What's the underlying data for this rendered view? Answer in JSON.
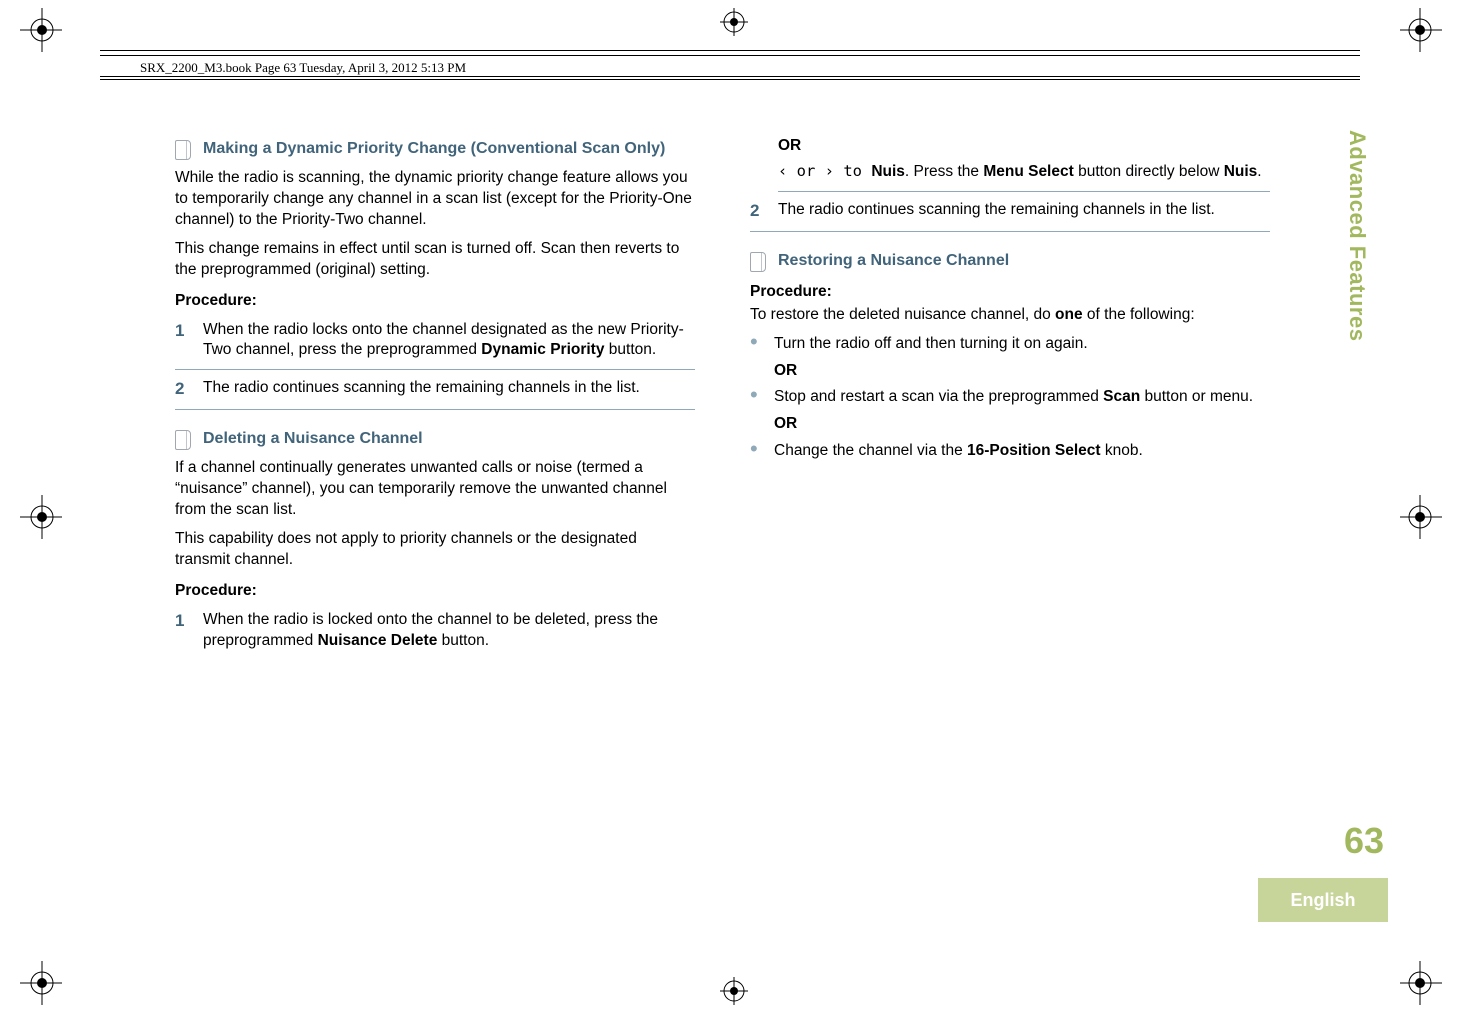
{
  "header_note": "SRX_2200_M3.book  Page 63  Tuesday, April 3, 2012  5:13 PM",
  "side_tab": "Advanced Features",
  "page_number": "63",
  "language": "English",
  "left": {
    "section1": {
      "title": "Making a Dynamic Priority Change (Conventional Scan Only)",
      "p1": "While the radio is scanning, the dynamic priority change feature allows you to temporarily change any channel in a scan list (except for the Priority-One channel) to the Priority-Two channel.",
      "p2": "This change remains in effect until scan is turned off. Scan then reverts to the preprogrammed (original) setting.",
      "proc": "Procedure:",
      "step1_num": "1",
      "step1_a": "When the radio locks onto the channel designated as the new Priority-Two channel, press the preprogrammed ",
      "step1_b": "Dynamic Priority",
      "step1_c": " button.",
      "step2_num": "2",
      "step2": "The radio continues scanning the remaining channels in the list."
    },
    "section2": {
      "title": "Deleting a Nuisance Channel",
      "p1": "If a channel continually generates unwanted calls or noise (termed a “nuisance” channel), you can temporarily remove the unwanted channel from the scan list.",
      "p2": "This capability does not apply to priority channels or the designated transmit channel.",
      "proc": "Procedure:",
      "step1_num": "1",
      "step1_a": "When the radio is locked onto the channel to be deleted, press the preprogrammed ",
      "step1_b": "Nuisance Delete",
      "step1_c": " button."
    }
  },
  "right": {
    "or1": "OR",
    "line1_a": "‹ or › to ",
    "line1_b": "Nuis",
    "line1_c": ". Press the ",
    "line1_d": "Menu Select",
    "line1_e": " button directly below ",
    "line1_f": "Nuis",
    "line1_g": ".",
    "step2_num": "2",
    "step2": "The radio continues scanning the remaining channels in the list.",
    "section3": {
      "title": "Restoring a Nuisance Channel",
      "proc": "Procedure:",
      "intro_a": "To restore the deleted nuisance channel, do ",
      "intro_b": "one",
      "intro_c": " of the following:",
      "b1": "Turn the radio off and then turning it on again.",
      "or2": "OR",
      "b2_a": "Stop and restart a scan via the preprogrammed ",
      "b2_b": "Scan",
      "b2_c": " button or menu.",
      "or3": "OR",
      "b3_a": "Change the channel via the ",
      "b3_b": "16-Position Select",
      "b3_c": " knob."
    }
  }
}
